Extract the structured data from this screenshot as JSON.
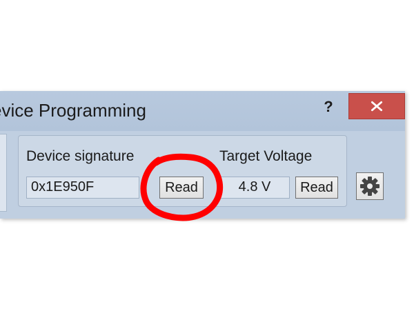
{
  "window": {
    "title": "evice Programming",
    "help_label": "?",
    "close_icon": "close-icon"
  },
  "device_signature": {
    "label": "Device signature",
    "value": "0x1E950F",
    "read_label": "Read"
  },
  "target_voltage": {
    "label": "Target Voltage",
    "value": "4.8 V",
    "read_label": "Read"
  },
  "settings": {
    "icon": "gear-icon"
  },
  "colors": {
    "titlebar": "#b8c9de",
    "close_button": "#c9504b",
    "annotation": "#ff0000"
  }
}
